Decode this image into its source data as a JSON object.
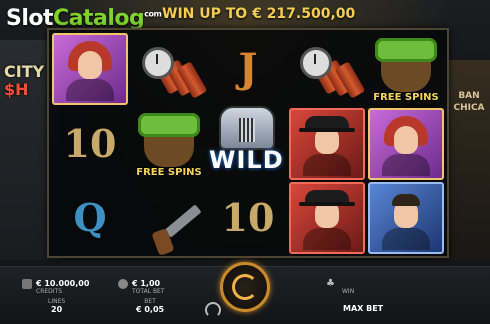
{
  "watermark": {
    "brand_a": "Slot",
    "brand_b": "Catalog",
    "tm": "com"
  },
  "game_logo": {
    "line1": "CITY",
    "line2": "$H"
  },
  "win_banner": "WIN UP TO € 217.500,00",
  "bank_sign": "BAN CHICA",
  "reels": {
    "ten_top": "10",
    "queen": "Q",
    "jack": "J",
    "ten_bottom": "10",
    "wild_label": "WILD",
    "free_spins_1": "FREE SPINS",
    "free_spins_2": "FREE SPINS"
  },
  "status": {
    "credits_value": "€ 10.000,00",
    "credits_label": "CREDITS",
    "total_bet_value": "€ 1,00",
    "total_bet_label": "TOTAL BET",
    "win_label": "WIN"
  },
  "controls": {
    "lines_label": "LINES",
    "lines_value": "20",
    "bet_label": "BET",
    "bet_value": "€ 0,05",
    "max_bet": "MAX BET"
  },
  "colors": {
    "accent_gold": "#f6cd53",
    "brand_green": "#7fd32a",
    "spin_ring": "#c98a2a"
  }
}
